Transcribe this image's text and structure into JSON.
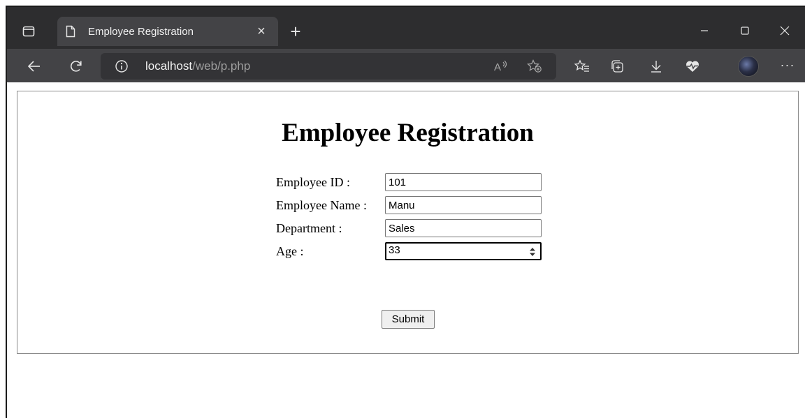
{
  "browser": {
    "tab_title": "Employee Registration",
    "tab_close": "×",
    "new_tab": "+",
    "address": {
      "host": "localhost",
      "path": "/web/p.php"
    },
    "more_menu": "···",
    "icons": [
      "tab-actions-icon",
      "page-icon",
      "back-icon",
      "refresh-icon",
      "info-icon",
      "read-aloud-icon",
      "add-favorite-icon",
      "favorites-icon",
      "collections-icon",
      "downloads-icon",
      "browser-essentials-icon",
      "profile-avatar",
      "minimize-icon",
      "maximize-icon",
      "close-icon"
    ]
  },
  "page": {
    "title": "Employee Registration",
    "fields": [
      {
        "label": "Employee ID :",
        "value": "101",
        "type": "text"
      },
      {
        "label": "Employee Name :",
        "value": "Manu",
        "type": "text"
      },
      {
        "label": "Department :",
        "value": "Sales",
        "type": "text"
      },
      {
        "label": "Age :",
        "value": "33",
        "type": "number"
      }
    ],
    "submit_label": "Submit"
  },
  "colors": {
    "titlebar": "#2d2d2f",
    "toolbar": "#434346",
    "addressbar": "#333336",
    "active_tab": "#434346"
  }
}
